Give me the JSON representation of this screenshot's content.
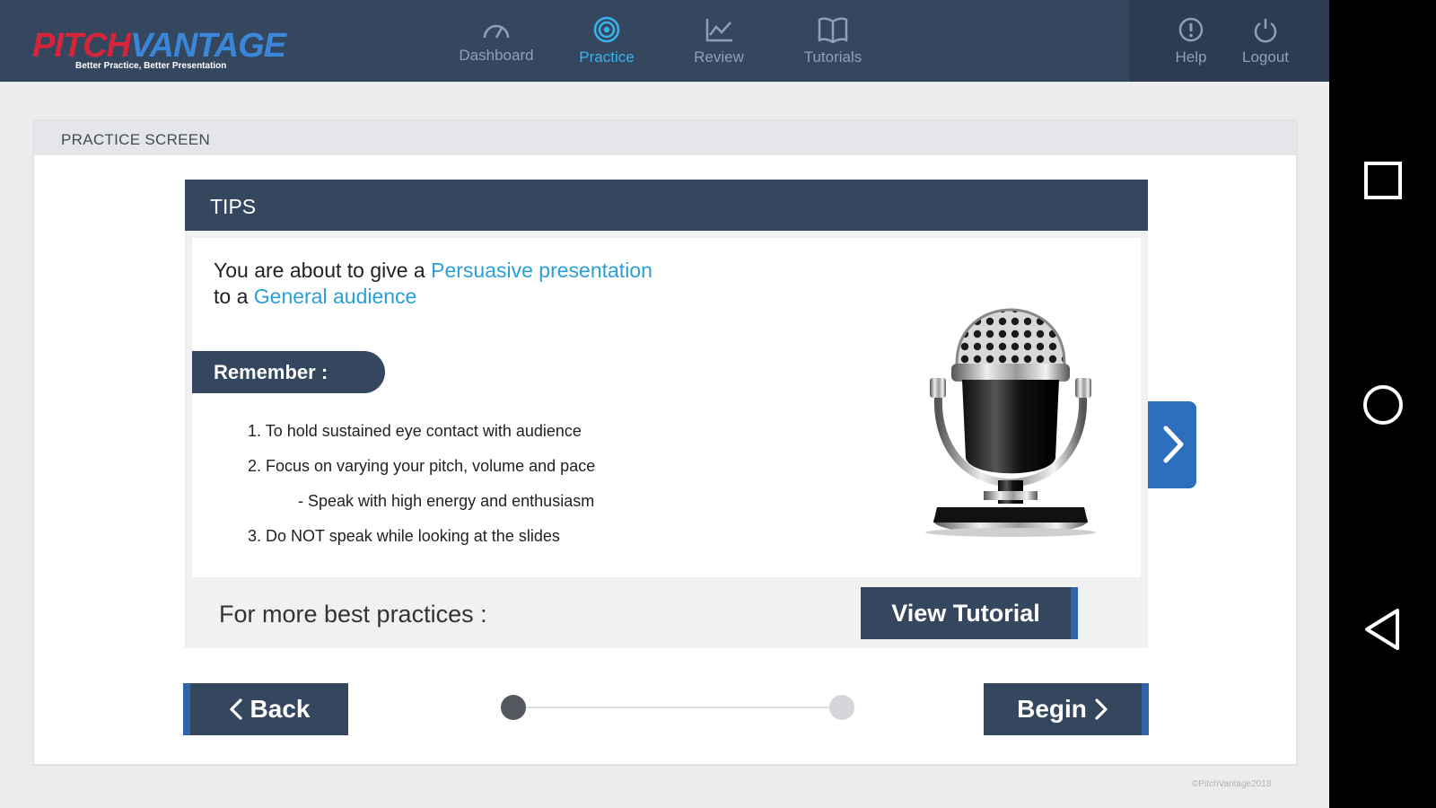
{
  "header": {
    "logo": {
      "word_left": "PITCH",
      "word_right": "VANTAGE",
      "tagline": "Better Practice, Better Presentation"
    },
    "nav": [
      {
        "label": "Dashboard",
        "icon": "gauge-icon",
        "active": false
      },
      {
        "label": "Practice",
        "icon": "target-icon",
        "active": true
      },
      {
        "label": "Review",
        "icon": "line-chart-icon",
        "active": false
      },
      {
        "label": "Tutorials",
        "icon": "book-icon",
        "active": false
      }
    ],
    "utility": [
      {
        "label": "Help",
        "icon": "info-icon"
      },
      {
        "label": "Logout",
        "icon": "power-icon"
      }
    ]
  },
  "card": {
    "title": "PRACTICE SCREEN",
    "tips": {
      "title": "TIPS",
      "intro": {
        "line1_prefix": "You are about to give a",
        "presentation_type": "Persuasive presentation",
        "line2_prefix": "to a",
        "audience": "General audience"
      },
      "remember_label": "Remember :",
      "items": [
        "1. To hold sustained eye contact with audience",
        "2. Focus on varying your pitch, volume and pace",
        "-  Speak with high energy and enthusiasm",
        "3. Do NOT speak while looking at the slides"
      ],
      "more_label": "For more best practices :",
      "view_tutorial_label": "View Tutorial"
    },
    "back_label": "Back",
    "begin_label": "Begin",
    "progress": {
      "current_step": 1,
      "total_steps": 2
    }
  },
  "copyright": "©PitchVantage2018",
  "colors": {
    "navy": "#34475f",
    "accent_blue": "#2a9fd8",
    "active_nav": "#3ab3ea",
    "side_bar_blue": "#2f66a8"
  },
  "system_nav": [
    "recents-square-icon",
    "home-circle-icon",
    "back-triangle-icon"
  ]
}
